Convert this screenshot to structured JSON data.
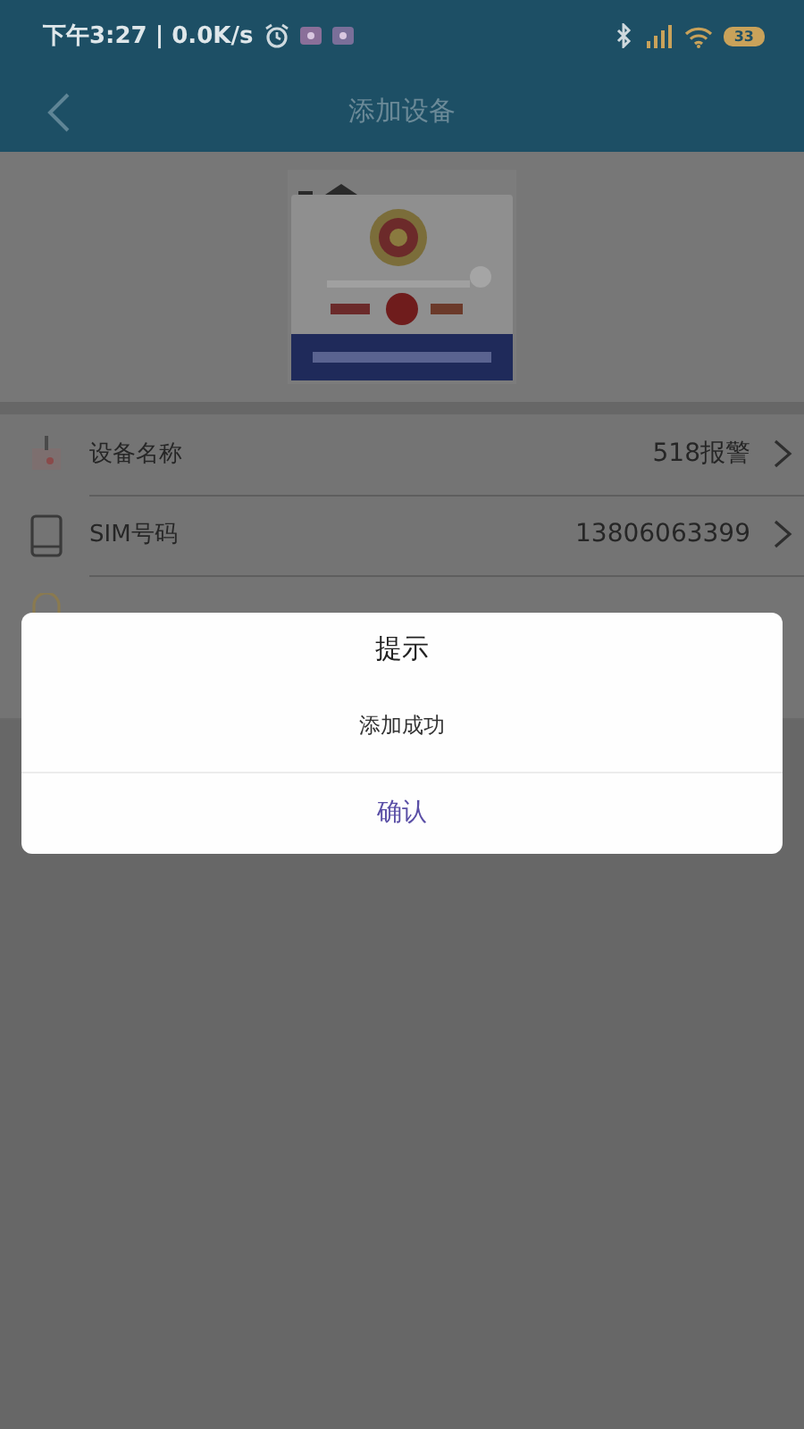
{
  "status_bar": {
    "time": "下午3:27 | 0.0K/s",
    "battery": "33"
  },
  "header": {
    "title": "添加设备"
  },
  "fields": [
    {
      "kind": "device",
      "label": "设备名称",
      "value": "518报警"
    },
    {
      "kind": "sim",
      "label": "SIM号码",
      "value": "13806063399"
    }
  ],
  "dialog": {
    "title": "提示",
    "message": "添加成功",
    "buttons": [
      "确认"
    ]
  }
}
